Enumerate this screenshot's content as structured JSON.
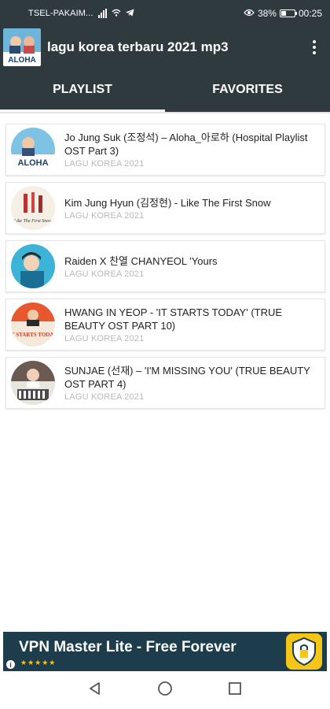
{
  "status_bar": {
    "carrier": "TSEL-PAKAIM...",
    "battery_percent": "38%",
    "battery_level": 0.38,
    "time": "00:25"
  },
  "app_bar": {
    "title": "lagu korea terbaru 2021 mp3",
    "icon_text": "ALOHA"
  },
  "tabs": [
    {
      "label": "PLAYLIST",
      "active": true
    },
    {
      "label": "FAVORITES",
      "active": false
    }
  ],
  "playlist": [
    {
      "title": "Jo Jung Suk (조정석) – Aloha_아로하 (Hospital Playlist OST Part 3)",
      "subtitle": "LAGU KOREA 2021",
      "thumb_text": "ALOHA"
    },
    {
      "title": "Kim Jung Hyun (김정현) - Like The First Snow",
      "subtitle": "LAGU KOREA 2021",
      "thumb_text": "Like The First Snow"
    },
    {
      "title": "Raiden X 찬열 CHANYEOL 'Yours",
      "subtitle": "LAGU KOREA 2021",
      "thumb_text": ""
    },
    {
      "title": "HWANG IN YEOP - 'IT STARTS TODAY' (TRUE BEAUTY OST PART 10)",
      "subtitle": "LAGU KOREA 2021",
      "thumb_text": "IT STARTS TODAY"
    },
    {
      "title": "SUNJAE (선재) – 'I'M MISSING YOU' (TRUE BEAUTY OST PART 4)",
      "subtitle": "LAGU KOREA 2021",
      "thumb_text": ""
    }
  ],
  "ad": {
    "title": "VPN Master Lite - Free Forever",
    "stars": "★★★★★",
    "info": "i"
  },
  "colors": {
    "app_bar": "#2f3a3e",
    "ad_background": "#1d3d4d",
    "ad_icon": "#f5c518"
  }
}
